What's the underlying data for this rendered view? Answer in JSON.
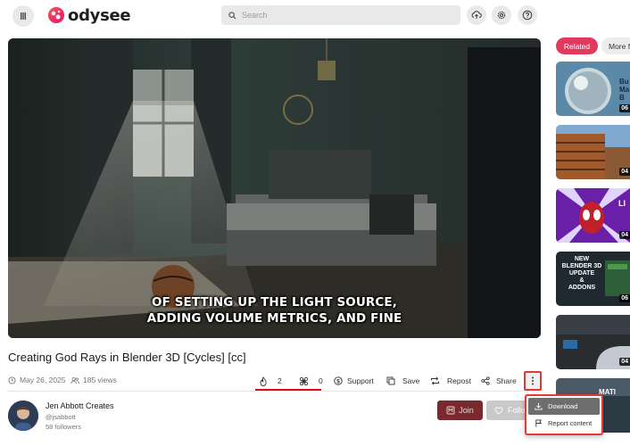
{
  "header": {
    "logo_text": "odysee",
    "search_placeholder": "Search",
    "icons": [
      "menu-icon",
      "upload-icon",
      "settings-icon",
      "help-icon"
    ]
  },
  "video": {
    "caption_line1": "OF SETTING UP THE LIGHT SOURCE,",
    "caption_line2": "ADDING VOLUME METRICS, AND FINE"
  },
  "title": "Creating God Rays in Blender 3D [Cycles] [cc]",
  "meta": {
    "date": "May 26, 2025",
    "views": "185 views"
  },
  "actions": {
    "fire_count": "2",
    "slime_count": "0",
    "support": "Support",
    "save": "Save",
    "repost": "Repost",
    "share": "Share"
  },
  "channel": {
    "name": "Jen Abbott Creates",
    "handle": "@jsabbott",
    "followers": "58 followers",
    "join": "Join",
    "follow": "Follow"
  },
  "menu": {
    "download": "Download",
    "report": "Report content"
  },
  "sidebar": {
    "tab_related": "Related",
    "tab_more": "More f",
    "thumbs": [
      {
        "label": "Bu\nMa\nB",
        "duration": "06"
      },
      {
        "label": "",
        "duration": "04"
      },
      {
        "label": "LI",
        "duration": "04"
      },
      {
        "label": "NEW\nBLENDER 3D\nUPDATE\n&\nADDONS",
        "duration": "06"
      },
      {
        "label": "",
        "duration": "04"
      },
      {
        "label": "MATI",
        "duration": ""
      }
    ]
  },
  "colors": {
    "accent": "#e23a5f",
    "highlight_red": "#e53935",
    "join_bg": "#7a2a2f"
  }
}
